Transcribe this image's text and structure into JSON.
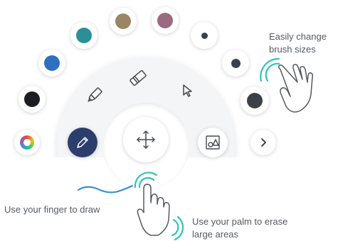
{
  "colors": {
    "brand_navy": "#2c3e6b",
    "accent_teal": "#2ec4b6",
    "stroke_blue": "#3a8fd6",
    "icon_dark": "#444a50"
  },
  "palette": [
    {
      "name": "rainbow",
      "color": "conic"
    },
    {
      "name": "black",
      "color": "#1b1d22"
    },
    {
      "name": "blue",
      "color": "#2e6fbf"
    },
    {
      "name": "teal",
      "color": "#2b8f97"
    },
    {
      "name": "brown",
      "color": "#9a8566"
    },
    {
      "name": "mauve",
      "color": "#9a6a80"
    }
  ],
  "brush_sizes": [
    {
      "size": "small",
      "color": "#3b4148"
    },
    {
      "size": "medium",
      "color": "#3b4148"
    },
    {
      "size": "large",
      "color": "#3b4148"
    }
  ],
  "tools": [
    "pencil-icon",
    "marker-icon",
    "eraser-icon",
    "pointer-icon",
    "move-icon",
    "shapes-icon",
    "chevron-right-icon"
  ],
  "captions": {
    "brush_sizes": [
      "Easily change",
      "brush sizes"
    ],
    "finger_draw": "Use your finger to draw",
    "palm_erase": [
      "Use your palm to erase",
      "large areas"
    ]
  }
}
